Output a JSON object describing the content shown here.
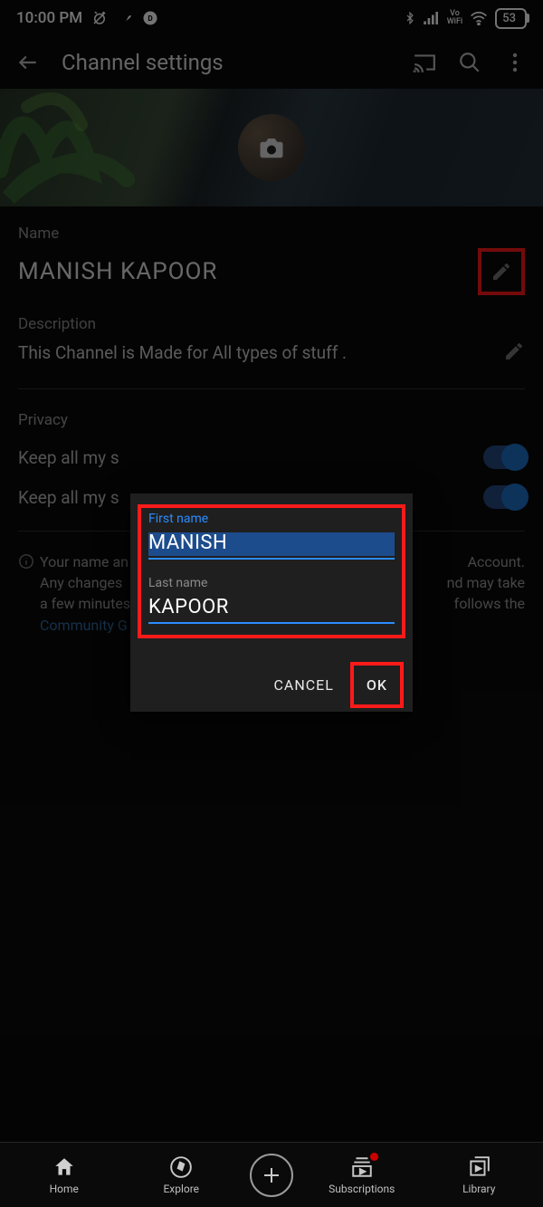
{
  "statusbar": {
    "time": "10:00 PM",
    "battery": "53"
  },
  "appbar": {
    "title": "Channel settings"
  },
  "name": {
    "label": "Name",
    "value": "MANISH KAPOOR"
  },
  "description": {
    "label": "Description",
    "value": "This Channel is Made for All types of stuff ."
  },
  "privacy": {
    "heading": "Privacy",
    "row1": "Keep all my s",
    "row2": "Keep all my s"
  },
  "info": {
    "line1": "Your name an",
    "line1b": "Account.",
    "line2": "Any changes ",
    "line2b": "nd may take",
    "line3": "a few minutes",
    "line3b": "follows the",
    "link": "Community G"
  },
  "dialog": {
    "first_label": "First name",
    "first_value": "MANISH",
    "last_label": "Last name",
    "last_value": "KAPOOR",
    "cancel": "CANCEL",
    "ok": "OK"
  },
  "nav": {
    "home": "Home",
    "explore": "Explore",
    "subs": "Subscriptions",
    "library": "Library"
  }
}
